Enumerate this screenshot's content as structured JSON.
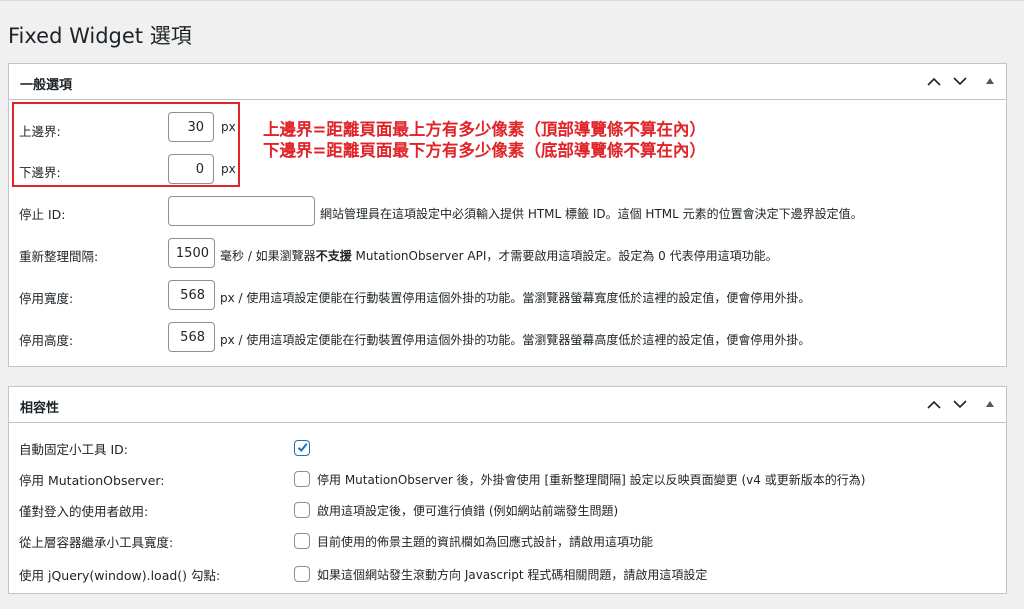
{
  "page": {
    "title": "Fixed Widget 選項"
  },
  "general": {
    "title": "一般選項",
    "margin_top": {
      "label": "上邊界:",
      "value": "30",
      "unit": "px"
    },
    "margin_bottom": {
      "label": "下邊界:",
      "value": "0",
      "unit": "px"
    },
    "stop_id": {
      "label": "停止 ID:",
      "value": "",
      "desc": "網站管理員在這項設定中必須輸入提供 HTML 標籤 ID。這個 HTML 元素的位置會決定下邊界設定值。"
    },
    "refresh_interval": {
      "label": "重新整理間隔:",
      "value": "1500",
      "desc_pre": "毫秒 / 如果瀏覽器",
      "desc_bold": "不支援",
      "desc_post": " MutationObserver API，才需要啟用這項設定。設定為 0 代表停用這項功能。"
    },
    "disable_width": {
      "label": "停用寬度:",
      "value": "568",
      "desc": "px / 使用這項設定便能在行動裝置停用這個外掛的功能。當瀏覽器螢幕寬度低於這裡的設定值，便會停用外掛。"
    },
    "disable_height": {
      "label": "停用高度:",
      "value": "568",
      "desc": "px / 使用這項設定便能在行動裝置停用這個外掛的功能。當瀏覽器螢幕高度低於這裡的設定值，便會停用外掛。"
    }
  },
  "annotation": {
    "line1": "上邊界=距離頁面最上方有多少像素（頂部導覽條不算在內）",
    "line2": "下邊界=距離頁面最下方有多少像素（底部導覽條不算在內）",
    "color": "#e0242a"
  },
  "compat": {
    "title": "相容性",
    "rows": [
      {
        "label": "自動固定小工具 ID:",
        "checked": true,
        "desc": ""
      },
      {
        "label": "停用 MutationObserver:",
        "checked": false,
        "desc": "停用 MutationObserver 後，外掛會使用 [重新整理間隔] 設定以反映頁面變更 (v4 或更新版本的行為)"
      },
      {
        "label": "僅對登入的使用者啟用:",
        "checked": false,
        "desc": "啟用這項設定後，便可進行偵錯 (例如網站前端發生問題)"
      },
      {
        "label": "從上層容器繼承小工具寬度:",
        "checked": false,
        "desc": "目前使用的佈景主題的資訊欄如為回應式設計，請啟用這項功能"
      },
      {
        "label": "使用 jQuery(window).load() 勾點:",
        "checked": false,
        "desc": "如果這個網站發生滾動方向 Javascript 程式碼相關問題，請啟用這項設定"
      }
    ]
  },
  "colors": {
    "accent": "#2271b1",
    "border": "#c3c4c7",
    "background": "#f0f0f1"
  },
  "icons": {
    "move_up": "chevron-up-icon",
    "move_down": "chevron-down-icon",
    "toggle": "triangle-up-icon"
  }
}
